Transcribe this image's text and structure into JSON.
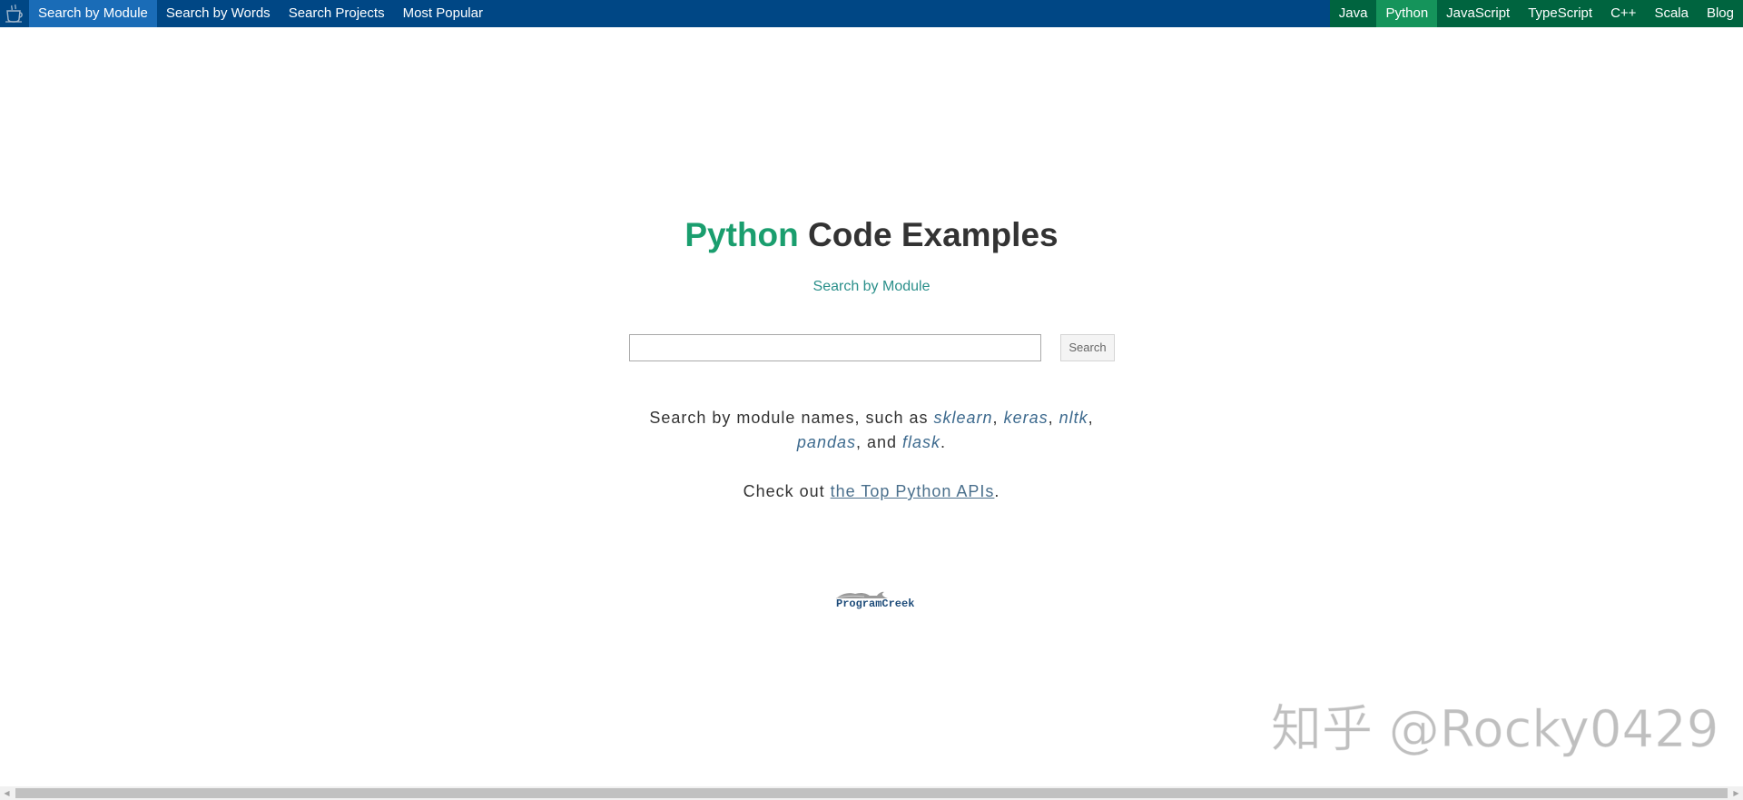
{
  "nav": {
    "left_items": [
      {
        "label": "Search by Module",
        "active": true
      },
      {
        "label": "Search by Words",
        "active": false
      },
      {
        "label": "Search Projects",
        "active": false
      },
      {
        "label": "Most Popular",
        "active": false
      }
    ],
    "right_items": [
      {
        "label": "Java",
        "active": false
      },
      {
        "label": "Python",
        "active": true
      },
      {
        "label": "JavaScript",
        "active": false
      },
      {
        "label": "TypeScript",
        "active": false
      },
      {
        "label": "C++",
        "active": false
      },
      {
        "label": "Scala",
        "active": false
      },
      {
        "label": "Blog",
        "active": false
      }
    ],
    "logo_icon": "coffee-cup-icon"
  },
  "main": {
    "title_accent": "Python",
    "title_rest": " Code Examples",
    "subtitle": "Search by Module",
    "search": {
      "value": "",
      "placeholder": "",
      "button_label": "Search"
    },
    "desc": {
      "prefix": "Search by module names, such as ",
      "modules": [
        "sklearn",
        "keras",
        "nltk",
        "pandas",
        "flask"
      ],
      "sep1": ", ",
      "sep2": ", ",
      "sep3": ",",
      "sep4": ", and ",
      "suffix": "."
    },
    "check": {
      "prefix": "Check out ",
      "link": "the Top Python APIs",
      "suffix": "."
    }
  },
  "footer_logo": {
    "text": "ProgramCreek"
  },
  "watermark": "知乎 @Rocky0429",
  "colors": {
    "topbar": "#004785",
    "nav_active": "#1a6cb7",
    "lang_bar": "#00643f",
    "lang_active": "#15945b",
    "accent": "#1a9e6e"
  }
}
